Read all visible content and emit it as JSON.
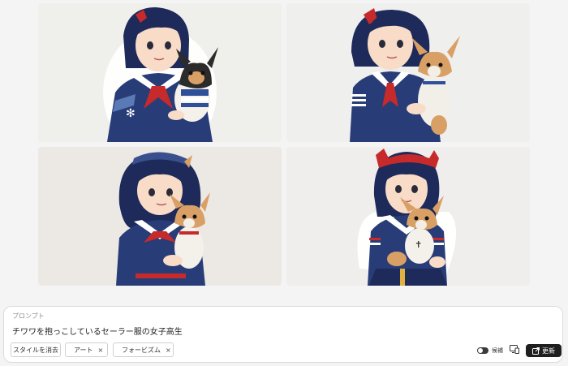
{
  "gallery": {
    "images": [
      {
        "icon": "girl-holding-chihuahua-illustration"
      },
      {
        "icon": "girl-holding-chihuahua-illustration"
      },
      {
        "icon": "girl-holding-chihuahua-illustration"
      },
      {
        "icon": "girl-holding-chihuahua-illustration"
      }
    ]
  },
  "prompt": {
    "label": "プロンプト",
    "text": "チワワを抱っこしているセーラー服の女子高生"
  },
  "styles": {
    "clear_label": "スタイルを消去",
    "chips": [
      {
        "label": "アート",
        "remove": "×",
        "thumb_color": "#7a6f63"
      },
      {
        "label": "フォービズム",
        "remove": "×",
        "thumb_color": "#8a7a4a"
      }
    ]
  },
  "controls": {
    "candidates_label": "候補",
    "candidates_on": true,
    "update_label": "更新"
  },
  "colors": {
    "uniform_navy": "#283c78",
    "ribbon_red": "#c62a2a",
    "hair": "#1e2a5a",
    "skin": "#f8dcc8",
    "dog_tan": "#d9a066",
    "button_dark": "#1f1f1f"
  }
}
